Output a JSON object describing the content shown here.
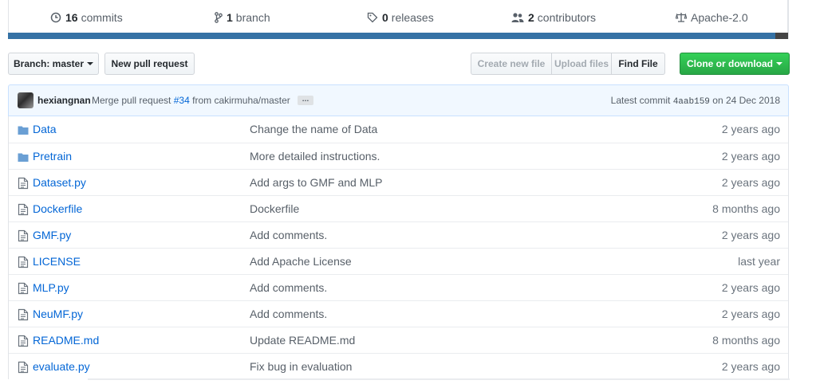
{
  "stats": {
    "commits": {
      "num": "16",
      "label": "commits",
      "icon": "history-icon"
    },
    "branches": {
      "num": "1",
      "label": "branch",
      "icon": "git-branch-icon"
    },
    "releases": {
      "num": "0",
      "label": "releases",
      "icon": "tag-icon"
    },
    "contributors": {
      "num": "2",
      "label": "contributors",
      "icon": "people-icon"
    },
    "license": {
      "label": "Apache-2.0",
      "icon": "law-icon"
    }
  },
  "colors": {
    "language_primary": "#3572A5",
    "link": "#0366d6",
    "clone_button": "#28a745"
  },
  "toolbar": {
    "branch_label": "Branch: master",
    "new_pr_label": "New pull request",
    "create_file_label": "Create new file",
    "upload_files_label": "Upload files",
    "find_file_label": "Find File",
    "clone_label": "Clone or download"
  },
  "commit": {
    "author": "hexiangnan",
    "message_prefix": "Merge pull request",
    "pr_link": "#34",
    "message_suffix": "from cakirmuha/master",
    "ellipsis": "…",
    "latest_label": "Latest commit",
    "sha": "4aab159",
    "date": "on 24 Dec 2018"
  },
  "files": [
    {
      "type": "dir",
      "icon": "folder-icon",
      "name": "Data",
      "message": "Change the name of Data",
      "age": "2 years ago"
    },
    {
      "type": "dir",
      "icon": "folder-icon",
      "name": "Pretrain",
      "message": "More detailed instructions.",
      "age": "2 years ago"
    },
    {
      "type": "file",
      "icon": "file-icon",
      "name": "Dataset.py",
      "message": "Add args to GMF and MLP",
      "age": "2 years ago"
    },
    {
      "type": "file",
      "icon": "file-icon",
      "name": "Dockerfile",
      "message": "Dockerfile",
      "age": "8 months ago"
    },
    {
      "type": "file",
      "icon": "file-icon",
      "name": "GMF.py",
      "message": "Add comments.",
      "age": "2 years ago"
    },
    {
      "type": "file",
      "icon": "file-icon",
      "name": "LICENSE",
      "message": "Add Apache License",
      "age": "last year"
    },
    {
      "type": "file",
      "icon": "file-icon",
      "name": "MLP.py",
      "message": "Add comments.",
      "age": "2 years ago"
    },
    {
      "type": "file",
      "icon": "file-icon",
      "name": "NeuMF.py",
      "message": "Add comments.",
      "age": "2 years ago"
    },
    {
      "type": "file",
      "icon": "file-icon",
      "name": "README.md",
      "message": "Update README.md",
      "age": "8 months ago"
    },
    {
      "type": "file",
      "icon": "file-icon",
      "name": "evaluate.py",
      "message": "Fix bug in evaluation",
      "age": "2 years ago"
    }
  ]
}
